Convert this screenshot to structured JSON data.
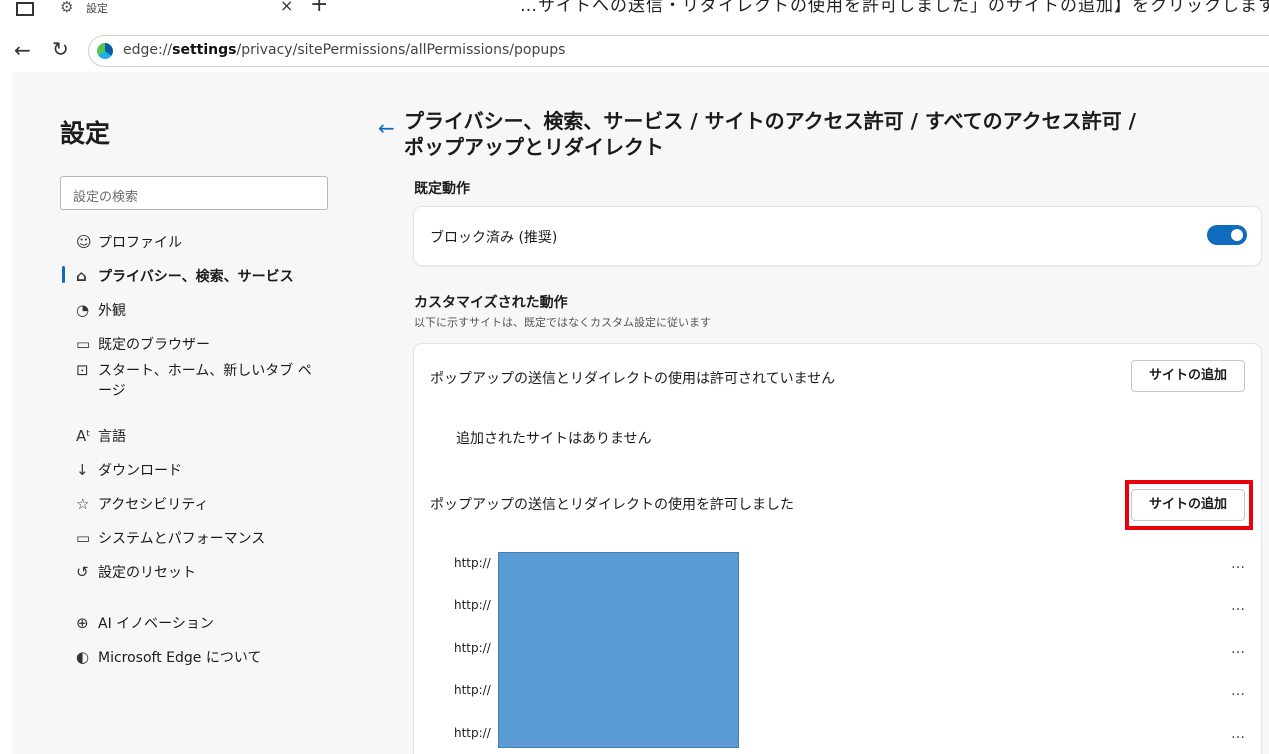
{
  "tab": {
    "title": "設定",
    "close": "×",
    "new_tab": "+"
  },
  "caption": "…サイトへの送信・リダイレクトの使用を許可しました」のサイトの追加】をクリックします。",
  "address": {
    "scheme": "edge://",
    "bold_part": "settings",
    "rest": "/privacy/sitePermissions/allPermissions/popups"
  },
  "sidebar": {
    "title": "設定",
    "search_placeholder": "設定の検索",
    "items": [
      {
        "label": "プロファイル",
        "icon": "profile-icon",
        "glyph": "☺"
      },
      {
        "label": "プライバシー、検索、サービス",
        "icon": "lock-icon",
        "glyph": "🔒",
        "active": true
      },
      {
        "label": "外観",
        "icon": "appearance-icon",
        "glyph": "◔"
      },
      {
        "label": "既定のブラウザー",
        "icon": "browser-icon",
        "glyph": "▭"
      },
      {
        "label": "スタート、ホーム、新しいタブ ペ",
        "label2": "ージ",
        "icon": "home-tab-icon",
        "glyph": "⊡"
      },
      {
        "label": "言語",
        "icon": "language-icon",
        "glyph": "Aᵗ"
      },
      {
        "label": "ダウンロード",
        "icon": "download-icon",
        "glyph": "↓"
      },
      {
        "label": "アクセシビリティ",
        "icon": "accessibility-icon",
        "glyph": "☆"
      },
      {
        "label": "システムとパフォーマンス",
        "icon": "system-icon",
        "glyph": "▭"
      },
      {
        "label": "設定のリセット",
        "icon": "reset-icon",
        "glyph": "↺"
      },
      {
        "label": "AI イノベーション",
        "icon": "ai-icon",
        "glyph": "⊕"
      },
      {
        "label": "Microsoft Edge について",
        "icon": "edge-icon",
        "glyph": "◐"
      }
    ]
  },
  "content": {
    "heading_line1": "プライバシー、検索、サービス / サイトのアクセス許可 / すべてのアクセス許可 /",
    "heading_line2": "ポップアップとリダイレクト",
    "default_section": "既定動作",
    "default_label": "ブロック済み (推奨)",
    "toggle_on": true,
    "custom_title": "カスタマイズされた動作",
    "custom_sub": "以下に示すサイトは、既定ではなくカスタム設定に従います",
    "blocked_label": "ポップアップの送信とリダイレクトの使用は許可されていません",
    "add_site": "サイトの追加",
    "empty_msg": "追加されたサイトはありません",
    "allowed_label": "ポップアップの送信とリダイレクトの使用を許可しました",
    "sites": [
      "http://",
      "http://",
      "http://",
      "http://",
      "http://"
    ],
    "more": "…"
  },
  "colors": {
    "accent": "#0f6cbd",
    "highlight": "#e8000b",
    "redaction": "#5b9bd5"
  }
}
